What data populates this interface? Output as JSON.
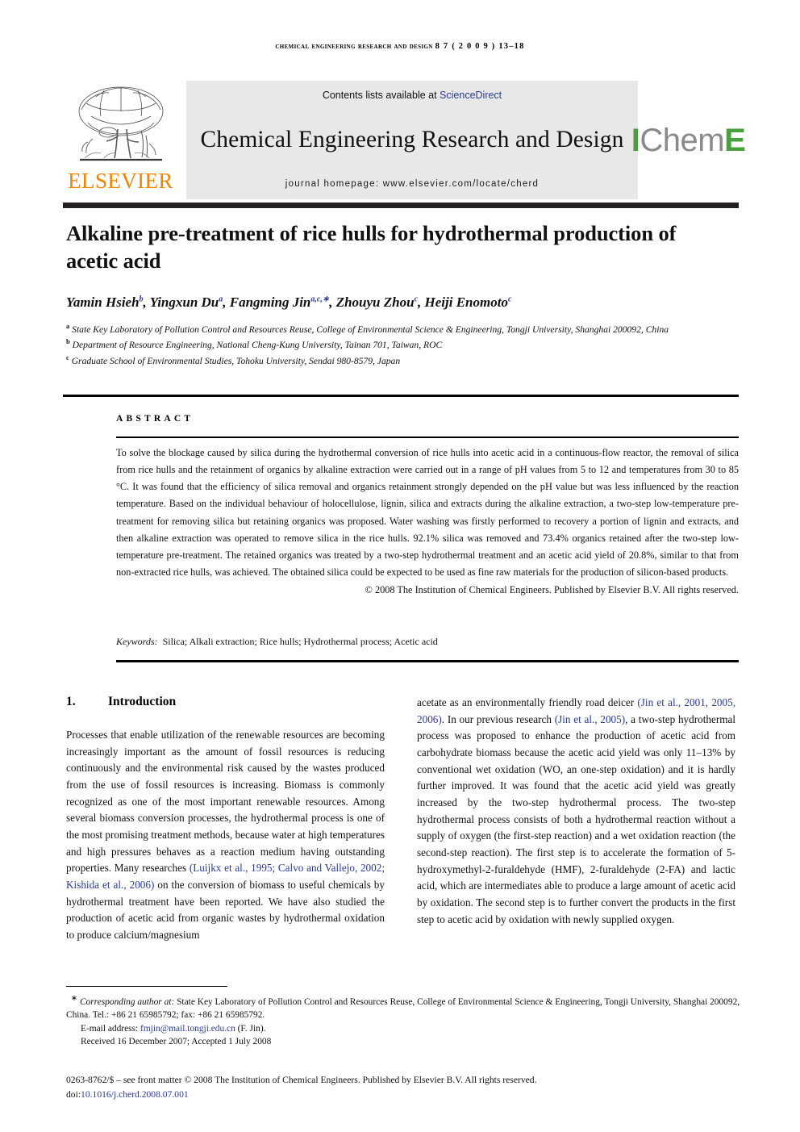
{
  "running_head": {
    "journal_caps": "Chemical Engineering Research and Design",
    "volume_issue_pages": "8 7   ( 2 0 0 9 )  13–18"
  },
  "masthead": {
    "elsevier_wordmark": "ELSEVIER",
    "contents_prefix": "Contents lists available at ",
    "sciencedirect_link": "ScienceDirect",
    "journal_title": "Chemical Engineering Research and Design",
    "homepage_line": "journal homepage: www.elsevier.com/locate/cherd",
    "icheme_i": "I",
    "icheme_chem": "Chem",
    "icheme_e": "E",
    "accent_green": "#4aa03f",
    "accent_orange": "#f08400",
    "link_blue": "#2b3c8f",
    "box_gray": "#e8e8e8"
  },
  "article": {
    "title": "Alkaline pre-treatment of rice hulls for hydrothermal production of acetic acid",
    "authors": [
      {
        "name": "Yamin Hsieh",
        "marks": "b",
        "sep": ", "
      },
      {
        "name": "Yingxun Du",
        "marks": "a",
        "sep": ", "
      },
      {
        "name": "Fangming Jin",
        "marks": "a,c,∗",
        "sep": ", "
      },
      {
        "name": "Zhouyu Zhou",
        "marks": "c",
        "sep": ", "
      },
      {
        "name": "Heiji Enomoto",
        "marks": "c",
        "sep": ""
      }
    ],
    "affiliations": [
      {
        "mark": "a",
        "text": "State Key Laboratory of Pollution Control and Resources Reuse, College of Environmental Science & Engineering, Tongji University, Shanghai 200092, China"
      },
      {
        "mark": "b",
        "text": "Department of Resource Engineering, National Cheng-Kung University, Tainan 701, Taiwan, ROC"
      },
      {
        "mark": "c",
        "text": "Graduate School of Environmental Studies, Tohoku University, Sendai 980-8579, Japan"
      }
    ]
  },
  "abstract": {
    "label": "ABSTRACT",
    "body": "To solve the blockage caused by silica during the hydrothermal conversion of rice hulls into acetic acid in a continuous-flow reactor, the removal of silica from rice hulls and the retainment of organics by alkaline extraction were carried out in a range of pH values from 5 to 12 and temperatures from 30 to 85 °C. It was found that the efficiency of silica removal and organics retainment strongly depended on the pH value but was less influenced by the reaction temperature. Based on the individual behaviour of holocellulose, lignin, silica and extracts during the alkaline extraction, a two-step low-temperature pre-treatment for removing silica but retaining organics was proposed. Water washing was firstly performed to recovery a portion of lignin and extracts, and then alkaline extraction was operated to remove silica in the rice hulls. 92.1% silica was removed and 73.4% organics retained after the two-step low-temperature pre-treatment. The retained organics was treated by a two-step hydrothermal treatment and an acetic acid yield of 20.8%, similar to that from non-extracted rice hulls, was achieved. The obtained silica could be expected to be used as fine raw materials for the production of silicon-based products.",
    "copyright": "© 2008 The Institution of Chemical Engineers. Published by Elsevier B.V. All rights reserved.",
    "keywords_label": "Keywords:",
    "keywords": "Silica; Alkali extraction; Rice hulls; Hydrothermal process; Acetic acid"
  },
  "introduction": {
    "number": "1.",
    "heading": "Introduction",
    "left_paragraph_part1": "Processes that enable utilization of the renewable resources are becoming increasingly important as the amount of fossil resources is reducing continuously and the environmental risk caused by the wastes produced from the use of fossil resources is increasing. Biomass is commonly recognized as one of the most important renewable resources. Among several biomass conversion processes, the hydrothermal process is one of the most promising treatment methods, because water at high temperatures and high pressures behaves as a reaction medium having outstanding properties. Many researches ",
    "left_citation_1": "(Luijkx et al., 1995; Calvo and Vallejo, 2002; Kishida et al., 2006)",
    "left_paragraph_part2": " on the conversion of biomass to useful chemicals by hydrothermal treatment have been reported. We have also studied the production of acetic acid from organic wastes by hydrothermal oxidation to produce calcium/magnesium ",
    "right_paragraph_part1": "acetate as an environmentally friendly road deicer ",
    "right_citation_1": "(Jin et al., 2001, 2005, 2006)",
    "right_paragraph_part2": ". In our previous research ",
    "right_citation_2": "(Jin et al., 2005)",
    "right_paragraph_part3": ", a two-step hydrothermal process was proposed to enhance the production of acetic acid from carbohydrate biomass because the acetic acid yield was only 11–13% by conventional wet oxidation (WO, an one-step oxidation) and it is hardly further improved. It was found that the acetic acid yield was greatly increased by the two-step hydrothermal process. The two-step hydrothermal process consists of both a hydrothermal reaction without a supply of oxygen (the first-step reaction) and a wet oxidation reaction (the second-step reaction). The first step is to accelerate the formation of 5-hydroxymethyl-2-furaldehyde (HMF), 2-furaldehyde (2-FA) and lactic acid, which are intermediates able to produce a large amount of acetic acid by oxidation. The second step is to further convert the products in the first step to acetic acid by oxidation with newly supplied oxygen."
  },
  "footnotes": {
    "corresponding_star": "∗",
    "corresponding_label": "Corresponding author at:",
    "corresponding_text": " State Key Laboratory of Pollution Control and Resources Reuse, College of Environmental Science & Engineering, Tongji University, Shanghai 200092, China. Tel.: +86 21 65985792; fax: +86 21 65985792.",
    "email_label": "E-mail address:",
    "email_address": "fmjin@mail.tongji.edu.cn",
    "email_suffix": " (F. Jin).",
    "dates": "Received 16 December 2007; Accepted 1 July 2008",
    "issn_line": "0263-8762/$ – see front matter © 2008 The Institution of Chemical Engineers. Published by Elsevier B.V. All rights reserved.",
    "doi_prefix": "doi:",
    "doi": "10.1016/j.cherd.2008.07.001"
  }
}
